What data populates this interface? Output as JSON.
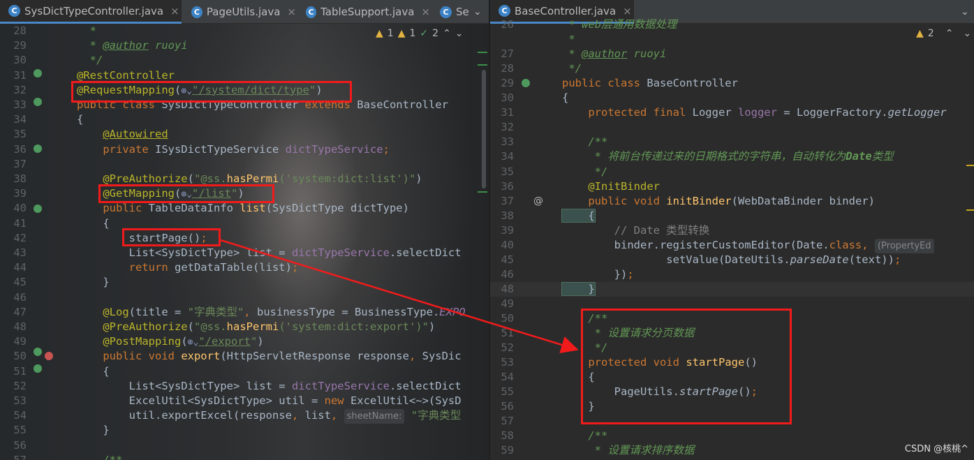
{
  "left": {
    "tabs": [
      {
        "label": "SysDictTypeController.java",
        "icon": "C",
        "active": true
      },
      {
        "label": "PageUtils.java",
        "icon": "C"
      },
      {
        "label": "TableSupport.java",
        "icon": "C"
      },
      {
        "label": "Se",
        "icon": "C"
      }
    ],
    "indicators": {
      "warnings": "1",
      "weak": "1",
      "ok": "2"
    },
    "lines": [
      {
        "n": "28",
        "parts": [
          [
            "c",
            "  *"
          ]
        ]
      },
      {
        "n": "29",
        "parts": [
          [
            "c",
            "  * "
          ],
          [
            "cu",
            "@author"
          ],
          [
            "c",
            " ruoyi"
          ]
        ]
      },
      {
        "n": "30",
        "parts": [
          [
            "c",
            "  */"
          ]
        ]
      },
      {
        "n": "31",
        "parts": [
          [
            "a",
            "@RestController"
          ]
        ]
      },
      {
        "n": "32",
        "parts": [
          [
            "a",
            "@RequestMapping"
          ],
          [
            "p",
            "("
          ],
          [
            "g",
            "⊕⌄"
          ],
          [
            "su",
            "\"/system/dict/type"
          ],
          [
            "s",
            "\""
          ],
          [
            "p",
            ")"
          ]
        ]
      },
      {
        "n": "33",
        "parts": [
          [
            "k",
            "public class "
          ],
          [
            "p",
            "SysDictTypeController "
          ],
          [
            "k",
            "extends "
          ],
          [
            "p",
            "BaseController"
          ]
        ]
      },
      {
        "n": "34",
        "parts": [
          [
            "p",
            "{"
          ]
        ]
      },
      {
        "n": "35",
        "parts": [
          [
            "p",
            "    "
          ],
          [
            "au",
            "@Autowired"
          ]
        ]
      },
      {
        "n": "36",
        "parts": [
          [
            "k",
            "    private "
          ],
          [
            "p",
            "ISysDictTypeService "
          ],
          [
            "fi",
            "dictTypeService"
          ],
          [
            "k",
            ";"
          ]
        ]
      },
      {
        "n": "37",
        "parts": []
      },
      {
        "n": "38",
        "parts": [
          [
            "a",
            "    @PreAuthorize"
          ],
          [
            "p",
            "("
          ],
          [
            "s",
            "\"@ss."
          ],
          [
            "f",
            "hasPermi"
          ],
          [
            "s",
            "('system:dict:list')\""
          ],
          [
            "p",
            ")"
          ]
        ]
      },
      {
        "n": "39",
        "parts": [
          [
            "a",
            "    @GetMapping"
          ],
          [
            "p",
            "("
          ],
          [
            "g",
            "⊕⌄"
          ],
          [
            "su",
            "\"/list"
          ],
          [
            "s",
            "\""
          ],
          [
            "p",
            ")"
          ]
        ]
      },
      {
        "n": "40",
        "parts": [
          [
            "k",
            "    public "
          ],
          [
            "p",
            "TableDataInfo "
          ],
          [
            "f",
            "list"
          ],
          [
            "p",
            "(SysDictType dictType)"
          ]
        ]
      },
      {
        "n": "41",
        "parts": [
          [
            "p",
            "    {"
          ]
        ]
      },
      {
        "n": "42",
        "parts": [
          [
            "p",
            "        startPage()"
          ],
          [
            "k",
            ";"
          ]
        ]
      },
      {
        "n": "43",
        "parts": [
          [
            "p",
            "        List<SysDictType> list = "
          ],
          [
            "fi",
            "dictTypeService"
          ],
          [
            "p",
            ".selectDict"
          ]
        ]
      },
      {
        "n": "44",
        "parts": [
          [
            "k",
            "        return "
          ],
          [
            "p",
            "getDataTable(list)"
          ],
          [
            "k",
            ";"
          ]
        ]
      },
      {
        "n": "45",
        "parts": [
          [
            "p",
            "    }"
          ]
        ]
      },
      {
        "n": "46",
        "parts": []
      },
      {
        "n": "47",
        "parts": [
          [
            "a",
            "    @Log"
          ],
          [
            "p",
            "(title = "
          ],
          [
            "s",
            "\"字典类型\""
          ],
          [
            "k",
            ", "
          ],
          [
            "p",
            "businessType = BusinessType."
          ],
          [
            "fiit",
            "EXPO"
          ]
        ]
      },
      {
        "n": "48",
        "parts": [
          [
            "a",
            "    @PreAuthorize"
          ],
          [
            "p",
            "("
          ],
          [
            "s",
            "\"@ss."
          ],
          [
            "f",
            "hasPermi"
          ],
          [
            "s",
            "('system:dict:export')\""
          ],
          [
            "p",
            ")"
          ]
        ]
      },
      {
        "n": "49",
        "parts": [
          [
            "a",
            "    @PostMapping"
          ],
          [
            "p",
            "("
          ],
          [
            "g",
            "⊕⌄"
          ],
          [
            "su",
            "\"/export"
          ],
          [
            "s",
            "\""
          ],
          [
            "p",
            ")"
          ]
        ]
      },
      {
        "n": "50",
        "parts": [
          [
            "k",
            "    public void "
          ],
          [
            "f",
            "export"
          ],
          [
            "p",
            "(HttpServletResponse response"
          ],
          [
            "k",
            ", "
          ],
          [
            "p",
            "SysDic"
          ]
        ]
      },
      {
        "n": "51",
        "parts": [
          [
            "p",
            "    {"
          ]
        ]
      },
      {
        "n": "52",
        "parts": [
          [
            "p",
            "        List<SysDictType> list = "
          ],
          [
            "fi",
            "dictTypeService"
          ],
          [
            "p",
            ".selectDict"
          ]
        ]
      },
      {
        "n": "53",
        "parts": [
          [
            "p",
            "        ExcelUtil<SysDictType> util = "
          ],
          [
            "k",
            "new "
          ],
          [
            "p",
            "ExcelUtil<~>(SysD"
          ]
        ]
      },
      {
        "n": "54",
        "parts": [
          [
            "p",
            "        util.exportExcel(response"
          ],
          [
            "k",
            ", "
          ],
          [
            "p",
            "list"
          ],
          [
            "k",
            ", "
          ],
          [
            "h",
            "sheetName:"
          ],
          [
            "s",
            " \"字典类型"
          ]
        ]
      },
      {
        "n": "55",
        "parts": [
          [
            "p",
            "    }"
          ]
        ]
      },
      {
        "n": "56",
        "parts": []
      },
      {
        "n": "57",
        "parts": [
          [
            "c",
            "    /**"
          ]
        ]
      }
    ]
  },
  "right": {
    "tabs": [
      {
        "label": "BaseController.java",
        "icon": "C",
        "active": true
      }
    ],
    "indicators": {
      "warnings": "2"
    },
    "lines": [
      {
        "n": "26",
        "parts": [
          [
            "c",
            " * web层通用数据处理"
          ]
        ]
      },
      {
        "n": "",
        "parts": [
          [
            "c",
            " *"
          ]
        ]
      },
      {
        "n": "27",
        "parts": [
          [
            "c",
            " * "
          ],
          [
            "cu",
            "@author"
          ],
          [
            "c",
            " ruoyi"
          ]
        ]
      },
      {
        "n": "28",
        "parts": [
          [
            "c",
            " */"
          ]
        ]
      },
      {
        "n": "29",
        "parts": [
          [
            "k",
            "public class "
          ],
          [
            "p",
            "BaseController"
          ]
        ]
      },
      {
        "n": "30",
        "parts": [
          [
            "p",
            "{"
          ]
        ]
      },
      {
        "n": "31",
        "parts": [
          [
            "k",
            "    protected final "
          ],
          [
            "p",
            "Logger "
          ],
          [
            "fi",
            "logger"
          ],
          [
            "p",
            " = LoggerFactory."
          ],
          [
            "pit",
            "getLogger"
          ]
        ]
      },
      {
        "n": "32",
        "parts": []
      },
      {
        "n": "33",
        "parts": [
          [
            "c",
            "    /**"
          ]
        ]
      },
      {
        "n": "34",
        "parts": [
          [
            "c",
            "     * 将前台传递过来的日期格式的字符串，自动转化为"
          ],
          [
            "cb",
            "Date"
          ],
          [
            "c",
            "类型"
          ]
        ]
      },
      {
        "n": "35",
        "parts": [
          [
            "c",
            "     */"
          ]
        ]
      },
      {
        "n": "36",
        "parts": [
          [
            "a",
            "    @InitBinder"
          ]
        ]
      },
      {
        "n": "37",
        "parts": [
          [
            "k",
            "    public void "
          ],
          [
            "f",
            "initBinder"
          ],
          [
            "p",
            "(WebDataBinder binder)"
          ]
        ]
      },
      {
        "n": "38",
        "parts": [
          [
            "hl",
            "    {"
          ]
        ]
      },
      {
        "n": "39",
        "parts": [
          [
            "cm",
            "        // Date 类型转换"
          ]
        ]
      },
      {
        "n": "40",
        "parts": [
          [
            "p",
            "        binder.registerCustomEditor(Date."
          ],
          [
            "k",
            "class"
          ],
          [
            "k",
            ", "
          ],
          [
            "h",
            "(PropertyEd"
          ]
        ]
      },
      {
        "n": "45",
        "parts": [
          [
            "p",
            "                setValue(DateUtils."
          ],
          [
            "pit",
            "parseDate"
          ],
          [
            "p",
            "(text))"
          ],
          [
            "k",
            ";"
          ]
        ]
      },
      {
        "n": "46",
        "parts": [
          [
            "p",
            "        })"
          ],
          [
            "k",
            ";"
          ]
        ]
      },
      {
        "n": "48",
        "parts": [
          [
            "hl",
            "    }"
          ]
        ]
      },
      {
        "n": "49",
        "parts": []
      },
      {
        "n": "50",
        "parts": [
          [
            "c",
            "    /**"
          ]
        ]
      },
      {
        "n": "51",
        "parts": [
          [
            "c",
            "     * 设置请求分页数据"
          ]
        ]
      },
      {
        "n": "52",
        "parts": [
          [
            "c",
            "     */"
          ]
        ]
      },
      {
        "n": "53",
        "parts": [
          [
            "k",
            "    protected void "
          ],
          [
            "f",
            "startPage"
          ],
          [
            "p",
            "()"
          ]
        ]
      },
      {
        "n": "54",
        "parts": [
          [
            "p",
            "    {"
          ]
        ]
      },
      {
        "n": "55",
        "parts": [
          [
            "p",
            "        PageUtils."
          ],
          [
            "pit",
            "startPage"
          ],
          [
            "p",
            "()"
          ],
          [
            "k",
            ";"
          ]
        ]
      },
      {
        "n": "56",
        "parts": [
          [
            "p",
            "    }"
          ]
        ]
      },
      {
        "n": "57",
        "parts": []
      },
      {
        "n": "58",
        "parts": [
          [
            "c",
            "    /**"
          ]
        ]
      },
      {
        "n": "59",
        "parts": [
          [
            "c",
            "     * 设置请求排序数据"
          ]
        ]
      }
    ]
  },
  "watermark": "CSDN @核桃^",
  "colors": {
    "keyword": "#cc7832",
    "annotation": "#bbb529",
    "string": "#6a8759",
    "comment": "#629755",
    "highlight_box": "#f21b1b",
    "tab_accent": "#4a88c7"
  }
}
